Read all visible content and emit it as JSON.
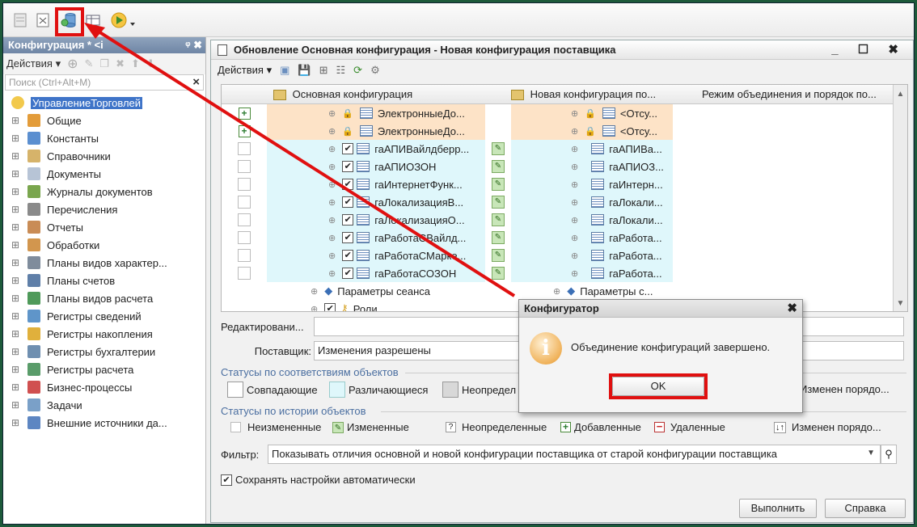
{
  "left_panel": {
    "title": "Конфигурация * <i",
    "pin": "ᵠ ✖",
    "actions_label": "Действия ▾",
    "search_placeholder": "Поиск (Ctrl+Alt+M)",
    "items": [
      {
        "label": "УправлениеТорговлей",
        "color": "#f2c94c"
      },
      {
        "label": "Общие",
        "color": "#e39c3a"
      },
      {
        "label": "Константы",
        "color": "#5b8fd0"
      },
      {
        "label": "Справочники",
        "color": "#d6b36a"
      },
      {
        "label": "Документы",
        "color": "#b7c4d6"
      },
      {
        "label": "Журналы документов",
        "color": "#7aa64e"
      },
      {
        "label": "Перечисления",
        "color": "#8a8a8a"
      },
      {
        "label": "Отчеты",
        "color": "#c98c56"
      },
      {
        "label": "Обработки",
        "color": "#d2964e"
      },
      {
        "label": "Планы видов характер...",
        "color": "#7f8c9c"
      },
      {
        "label": "Планы счетов",
        "color": "#5f7fa8"
      },
      {
        "label": "Планы видов расчета",
        "color": "#4f9a5a"
      },
      {
        "label": "Регистры сведений",
        "color": "#5f95c9"
      },
      {
        "label": "Регистры накопления",
        "color": "#e0b03c"
      },
      {
        "label": "Регистры бухгалтерии",
        "color": "#6f8fb0"
      },
      {
        "label": "Регистры расчета",
        "color": "#5a9c6a"
      },
      {
        "label": "Бизнес-процессы",
        "color": "#d05050"
      },
      {
        "label": "Задачи",
        "color": "#7aa0c8"
      },
      {
        "label": "Внешние источники да...",
        "color": "#5d86c2"
      }
    ]
  },
  "main": {
    "title": "Обновление Основная конфигурация - Новая конфигурация поставщика",
    "window_buttons": "_ ☐ ✖",
    "actions_label": "Действия ▾",
    "col_main": "Основная конфигурация",
    "col_new": "Новая конфигурация по...",
    "col_mode": "Режим объединения и порядок по...",
    "rows": [
      {
        "main": "ЭлектронныеДо...",
        "new": "<Отсу...",
        "mark": "plus",
        "hl": "orange",
        "check": false
      },
      {
        "main": "ЭлектронныеДо...",
        "new": "<Отсу...",
        "mark": "plus",
        "hl": "orange",
        "check": false
      },
      {
        "main": "гаАПИВайлдберр...",
        "new": "гаАПИВа...",
        "mark": "box",
        "hl": "cyan",
        "check": true
      },
      {
        "main": "гаАПИОЗОН",
        "new": "гаАПИОЗ...",
        "mark": "box",
        "hl": "cyan",
        "check": true
      },
      {
        "main": "гаИнтернетФунк...",
        "new": "гаИнтерн...",
        "mark": "box",
        "hl": "cyan",
        "check": true
      },
      {
        "main": "гаЛокализацияВ...",
        "new": "гаЛокали...",
        "mark": "box",
        "hl": "cyan",
        "check": true
      },
      {
        "main": "гаЛокализацияО...",
        "new": "гаЛокали...",
        "mark": "box",
        "hl": "cyan",
        "check": true
      },
      {
        "main": "гаРаботаСВайлд...",
        "new": "гаРабота...",
        "mark": "box",
        "hl": "cyan",
        "check": true
      },
      {
        "main": "гаРаботаСМарке...",
        "new": "гаРабота...",
        "mark": "box",
        "hl": "cyan",
        "check": true
      },
      {
        "main": "гаРаботаСОЗОН",
        "new": "гаРабота...",
        "mark": "box",
        "hl": "cyan",
        "check": true
      }
    ],
    "session_params": "Параметры сеанса",
    "session_params_new": "Параметры с...",
    "roles": "Роли",
    "edit_label": "Редактировани...",
    "supplier_label": "Поставщик:",
    "supplier_value": "Изменения разрешены",
    "group1_title": "Статусы по соответствиям объектов",
    "status_match": "Совпадающие",
    "status_diff": "Различающиеся",
    "status_undef1": "Неопредел",
    "status_order1": "Изменен порядо...",
    "group2_title": "Статусы по истории объектов",
    "hist_unchanged": "Неизмененные",
    "hist_changed": "Измененные",
    "hist_undef": "Неопределенные",
    "hist_added": "Добавленные",
    "hist_deleted": "Удаленные",
    "hist_order": "Изменен порядо...",
    "filter_label": "Фильтр:",
    "filter_value": "Показывать отличия основной и новой конфигурации поставщика от старой конфигурации поставщика",
    "save_settings": "Сохранять настройки автоматически",
    "run_btn": "Выполнить",
    "help_btn": "Справка"
  },
  "dialog": {
    "title": "Конфигуратор",
    "message": "Объединение конфигураций завершено.",
    "ok": "OK"
  },
  "colors": {
    "highlight_red": "#e01010",
    "orange_row": "#fde3c7",
    "cyan_row": "#dff7fb",
    "selection": "#3f74c8"
  }
}
